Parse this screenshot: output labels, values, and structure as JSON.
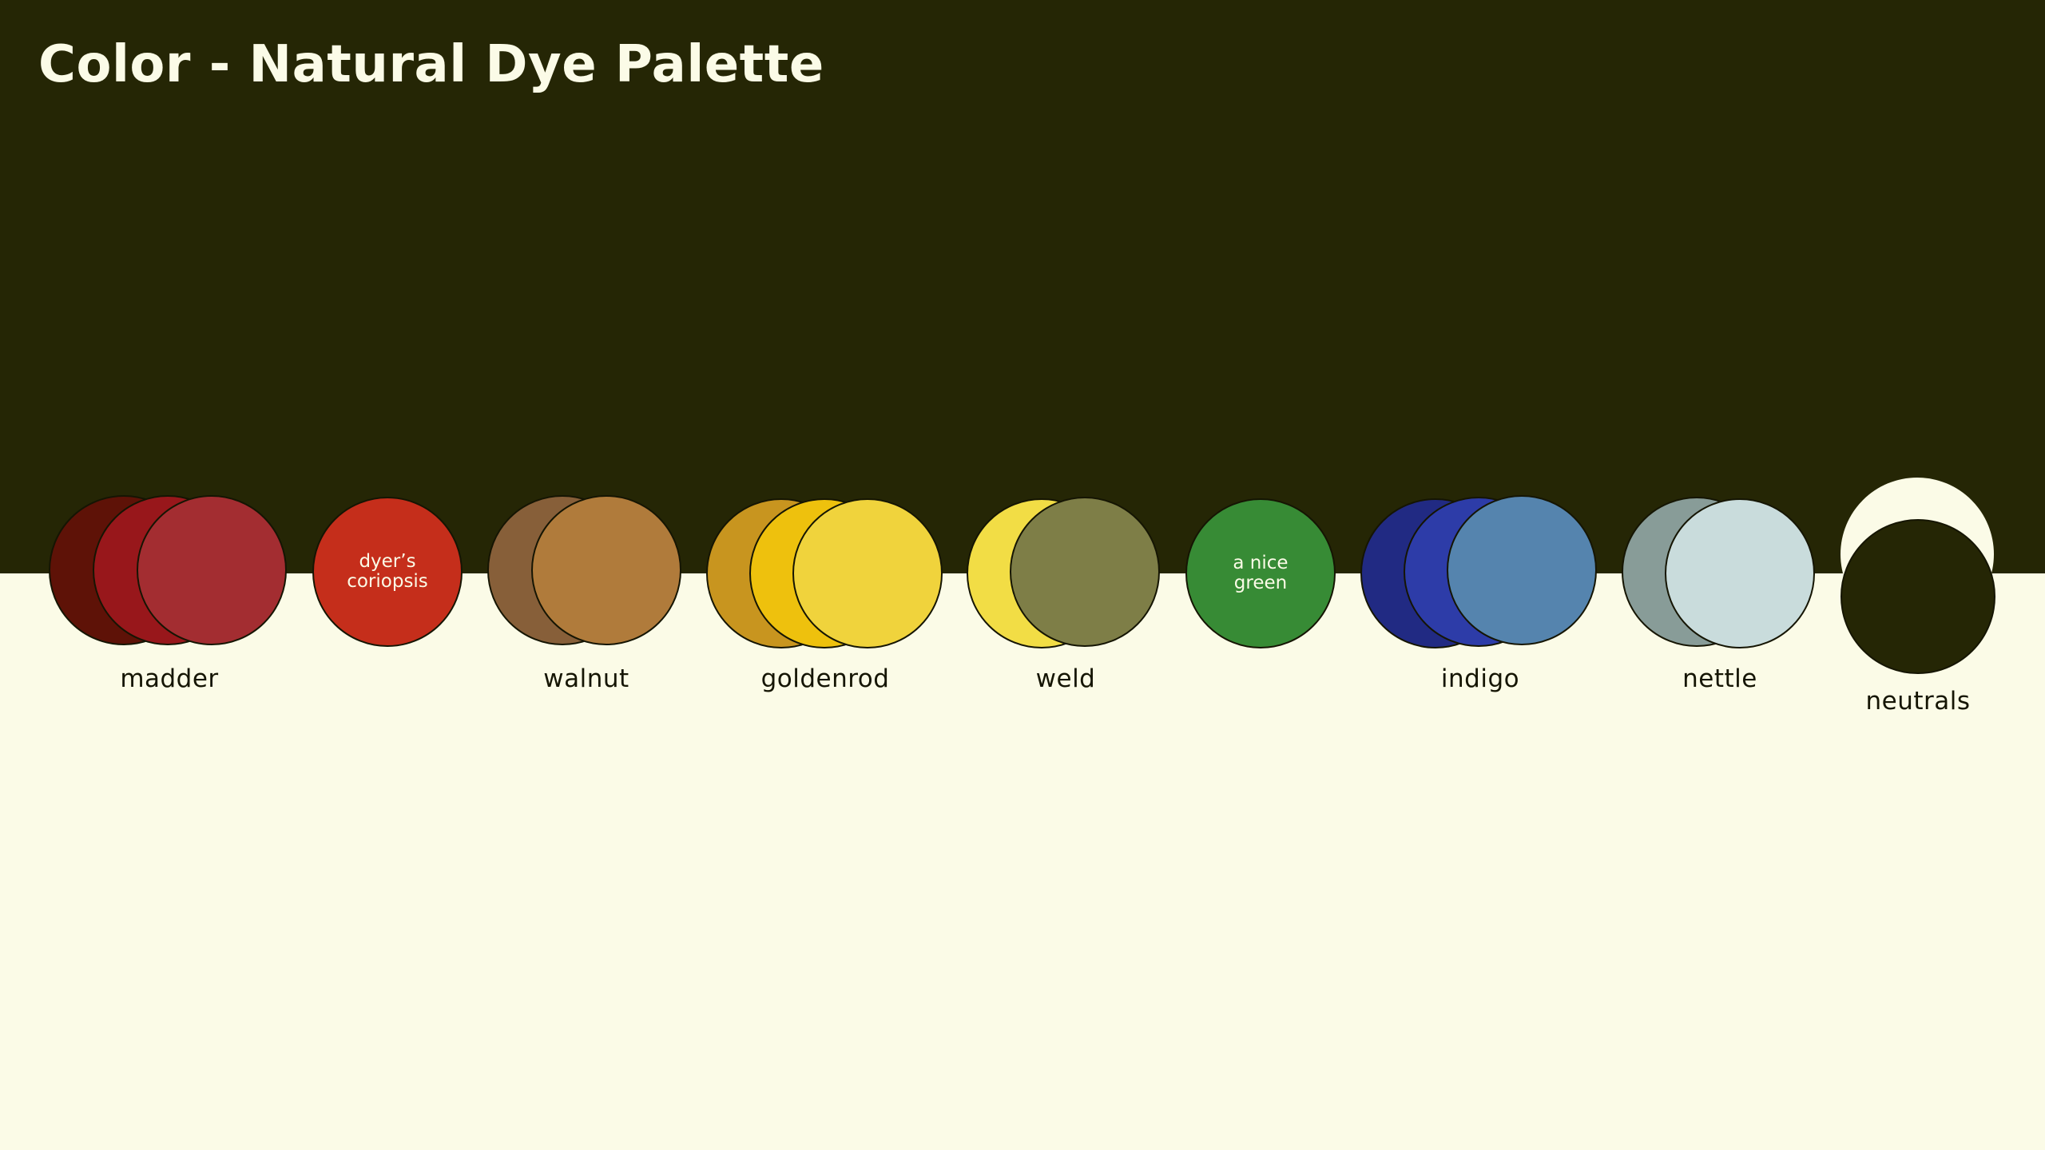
{
  "title": "Color - Natural Dye Palette",
  "colors": {
    "top_band": "#252605",
    "background": "#fbfbe7",
    "madder": [
      "#5e1207",
      "#98171b",
      "#a32d31"
    ],
    "dyers_coriopsis": "#c52e1b",
    "walnut": [
      "#875f39",
      "#b07b3b"
    ],
    "goldenrod": [
      "#c8951f",
      "#eec10d",
      "#f0d33c"
    ],
    "weld": [
      "#f2dd45",
      "#7e7e47"
    ],
    "green": "#378b35",
    "indigo": [
      "#212a83",
      "#2d3ca8",
      "#5584ae"
    ],
    "nettle": [
      "#889c98",
      "#c9dcdc"
    ],
    "neutrals": [
      "#fbfbe7",
      "#252605"
    ]
  },
  "swatches": {
    "madder": "madder",
    "dyers_coriopsis": "dyer’s\ncoriopsis",
    "walnut": "walnut",
    "goldenrod": "goldenrod",
    "weld": "weld",
    "green": "a nice\ngreen",
    "indigo": "indigo",
    "nettle": "nettle",
    "neutrals": "neutrals"
  }
}
